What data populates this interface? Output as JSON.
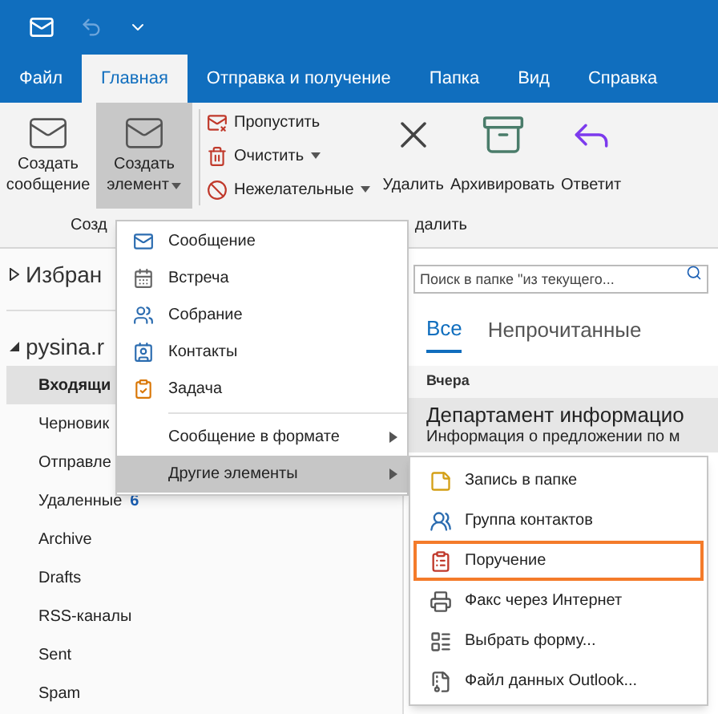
{
  "tabs": [
    {
      "label": "Файл",
      "selected": false
    },
    {
      "label": "Главная",
      "selected": true
    },
    {
      "label": "Отправка и получение",
      "selected": false
    },
    {
      "label": "Папка",
      "selected": false
    },
    {
      "label": "Вид",
      "selected": false
    },
    {
      "label": "Справка",
      "selected": false
    }
  ],
  "ribbon": {
    "large_buttons": [
      {
        "lines": [
          "Создать",
          "сообщение"
        ],
        "dropdown": false,
        "selected": false
      },
      {
        "lines": [
          "Создать",
          "элемент"
        ],
        "dropdown": true,
        "selected": true
      }
    ],
    "small_buttons": [
      {
        "label": "Пропустить",
        "dropdown": false
      },
      {
        "label": "Очистить",
        "dropdown": true
      },
      {
        "label": "Нежелательные",
        "dropdown": true
      }
    ],
    "action_buttons": [
      {
        "label": "Удалить"
      },
      {
        "label": "Архивировать"
      },
      {
        "label": "Ответит"
      }
    ],
    "group_labels": [
      "Созд",
      "далить"
    ]
  },
  "folders": {
    "favorites": {
      "label": "Избран",
      "expanded": false
    },
    "account": {
      "label": "pysina.r",
      "expanded": true,
      "children": [
        {
          "label": "Входящи",
          "selected": true
        },
        {
          "label": "Черновик",
          "selected": false
        },
        {
          "label": "Отправле",
          "selected": false
        },
        {
          "label": "Удаленные",
          "count": "6",
          "selected": false
        },
        {
          "label": "Archive",
          "selected": false
        },
        {
          "label": "Drafts",
          "selected": false
        },
        {
          "label": "RSS-каналы",
          "selected": false
        },
        {
          "label": "Sent",
          "selected": false
        },
        {
          "label": "Spam",
          "selected": false
        }
      ]
    }
  },
  "search": {
    "placeholder": "Поиск в папке \"из текущего..."
  },
  "filter_tabs": [
    {
      "label": "Все",
      "selected": true
    },
    {
      "label": "Непрочитанные",
      "selected": false
    }
  ],
  "group_header": "Вчера",
  "message": {
    "sender": "Департамент информацио",
    "preview": "Информация о предложении по м"
  },
  "menu": {
    "items": [
      {
        "kind": "item",
        "label": "Сообщение",
        "selected": false
      },
      {
        "kind": "item",
        "label": "Встреча",
        "selected": false
      },
      {
        "kind": "item",
        "label": "Собрание",
        "selected": false
      },
      {
        "kind": "item",
        "label": "Контакты",
        "selected": false
      },
      {
        "kind": "item",
        "label": "Задача",
        "selected": false
      },
      {
        "kind": "separator"
      },
      {
        "kind": "submenu",
        "label": "Сообщение в формате",
        "selected": false
      },
      {
        "kind": "submenu",
        "label": "Другие элементы",
        "selected": true
      }
    ]
  },
  "submenu": {
    "items": [
      {
        "label": "Запись в папке",
        "selected": false
      },
      {
        "label": "Группа контактов",
        "selected": false
      },
      {
        "label": "Поручение",
        "selected": true
      },
      {
        "label": "Факс через Интернет",
        "selected": false
      },
      {
        "label": "Выбрать форму...",
        "selected": false
      },
      {
        "label": "Файл данных Outlook...",
        "selected": false
      }
    ]
  }
}
